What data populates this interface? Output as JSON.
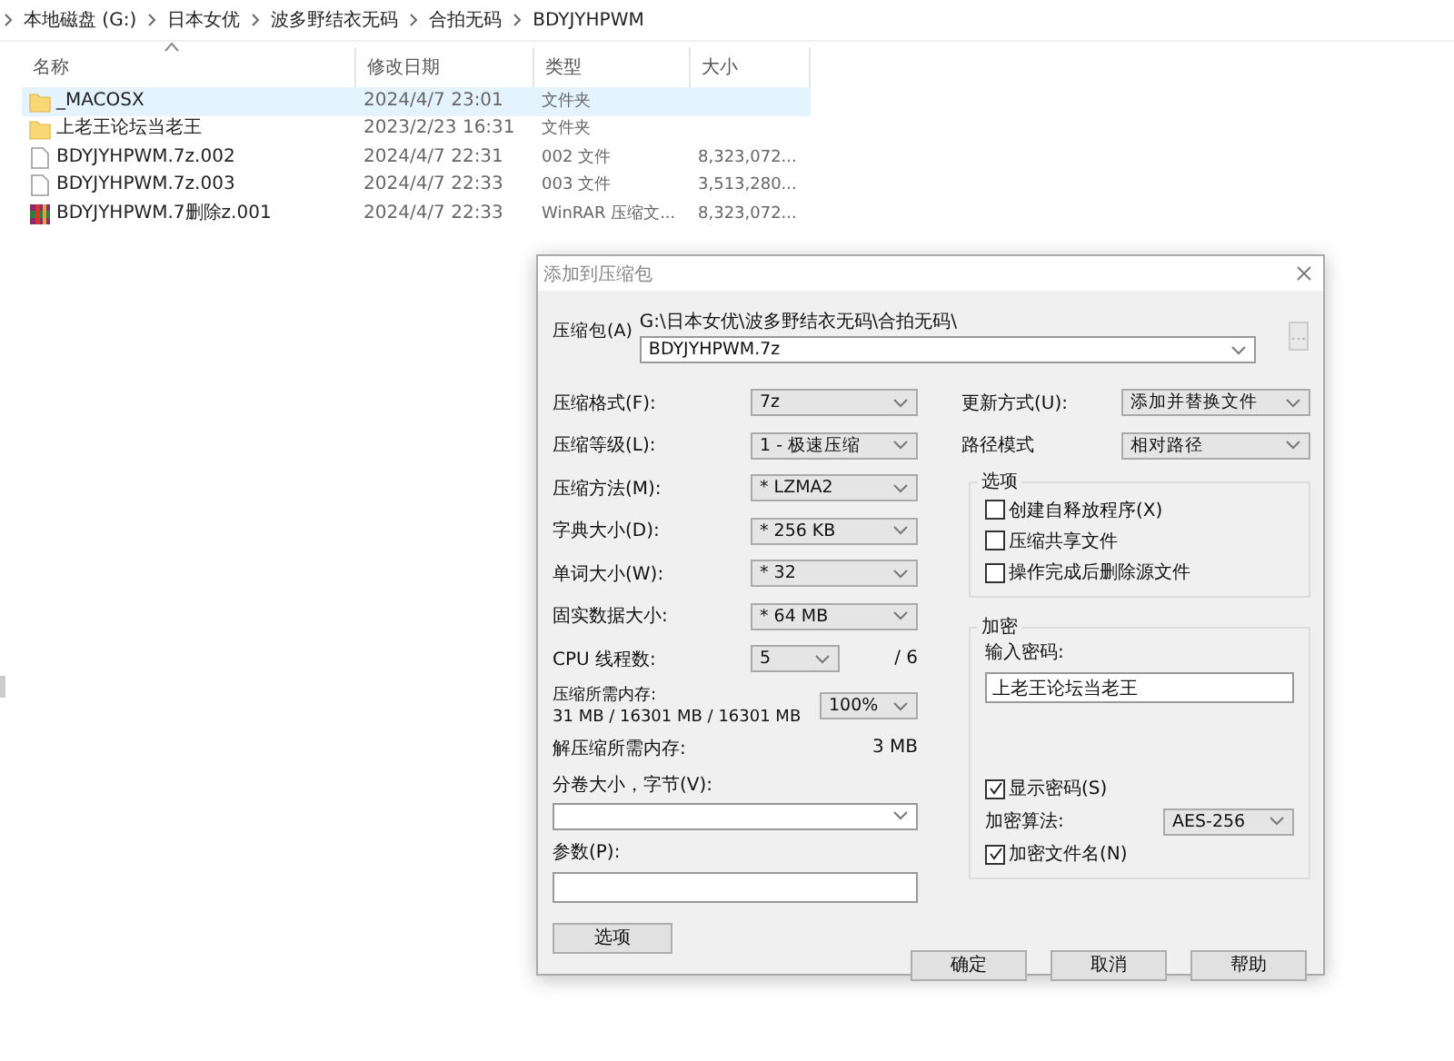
{
  "breadcrumb": [
    "本地磁盘 (G:)",
    "日本女优",
    "波多野结衣无码",
    "合拍无码",
    "BDYJYHPWM"
  ],
  "file_list": {
    "columns": [
      {
        "label": "名称",
        "sorted": true
      },
      {
        "label": "修改日期",
        "sorted": false
      },
      {
        "label": "类型",
        "sorted": false
      },
      {
        "label": "大小",
        "sorted": false
      }
    ],
    "rows": [
      {
        "kind": "folder",
        "name": "_MACOSX",
        "modified": "2024/4/7 23:01",
        "type": "文件夹",
        "size": "",
        "selected": true
      },
      {
        "kind": "folder",
        "name": "上老王论坛当老王",
        "modified": "2023/2/23 16:31",
        "type": "文件夹",
        "size": "",
        "selected": false
      },
      {
        "kind": "file",
        "name": "BDYJYHPWM.7z.002",
        "modified": "2024/4/7 22:31",
        "type": "002 文件",
        "size": "8,323,072...",
        "selected": false
      },
      {
        "kind": "file",
        "name": "BDYJYHPWM.7z.003",
        "modified": "2024/4/7 22:33",
        "type": "003 文件",
        "size": "3,513,280...",
        "selected": false
      },
      {
        "kind": "archive",
        "name": "BDYJYHPWM.7删除z.001",
        "modified": "2024/4/7 22:33",
        "type": "WinRAR 压缩文...",
        "size": "8,323,072...",
        "selected": false
      }
    ]
  },
  "dialog": {
    "title": "添加到压缩包",
    "archive_label": "压缩包(A)",
    "archive_path": "G:\\日本女优\\波多野结衣无码\\合拍无码\\",
    "archive_name": "BDYJYHPWM.7z",
    "browse_button": {
      "label": "...",
      "disabled": true
    },
    "left_rows": [
      {
        "kind": "combo",
        "label": "压缩格式(F):",
        "value": "7z"
      },
      {
        "kind": "combo",
        "label": "压缩等级(L):",
        "value": "1 - 极速压缩"
      },
      {
        "kind": "combo",
        "label": "压缩方法(M):",
        "value": "* LZMA2"
      },
      {
        "kind": "combo",
        "label": "字典大小(D):",
        "value": "* 256 KB"
      },
      {
        "kind": "combo",
        "label": "单词大小(W):",
        "value": "* 32"
      },
      {
        "kind": "combo",
        "label": "固实数据大小:",
        "value": "* 64 MB"
      },
      {
        "kind": "cpu",
        "label": "CPU 线程数:",
        "value": "5",
        "suffix": "/ 6"
      },
      {
        "kind": "memory",
        "label": "压缩所需内存:",
        "detail": "31 MB / 16301 MB / 16301 MB",
        "value": "100%"
      },
      {
        "kind": "reading",
        "label": "解压缩所需内存:",
        "value": "3 MB"
      },
      {
        "kind": "volume",
        "label": "分卷大小，字节(V):"
      },
      {
        "kind": "params",
        "label": "参数(P):"
      }
    ],
    "options_button": "选项",
    "right_rows": [
      {
        "label": "更新方式(U):",
        "value": "添加并替换文件"
      },
      {
        "label": "路径模式",
        "value": "相对路径"
      }
    ],
    "options_group": {
      "title": "选项",
      "checkboxes": [
        {
          "label": "创建自释放程序(X)",
          "checked": false
        },
        {
          "label": "压缩共享文件",
          "checked": false
        },
        {
          "label": "操作完成后删除源文件",
          "checked": false
        }
      ]
    },
    "encryption": {
      "title": "加密",
      "password_label": "输入密码:",
      "password": "上老王论坛当老王",
      "show_password": {
        "label": "显示密码(S)",
        "checked": true
      },
      "method_label": "加密算法:",
      "method": "AES-256",
      "encrypt_names": {
        "label": "加密文件名(N)",
        "checked": true
      }
    },
    "buttons": [
      "确定",
      "取消",
      "帮助"
    ]
  }
}
